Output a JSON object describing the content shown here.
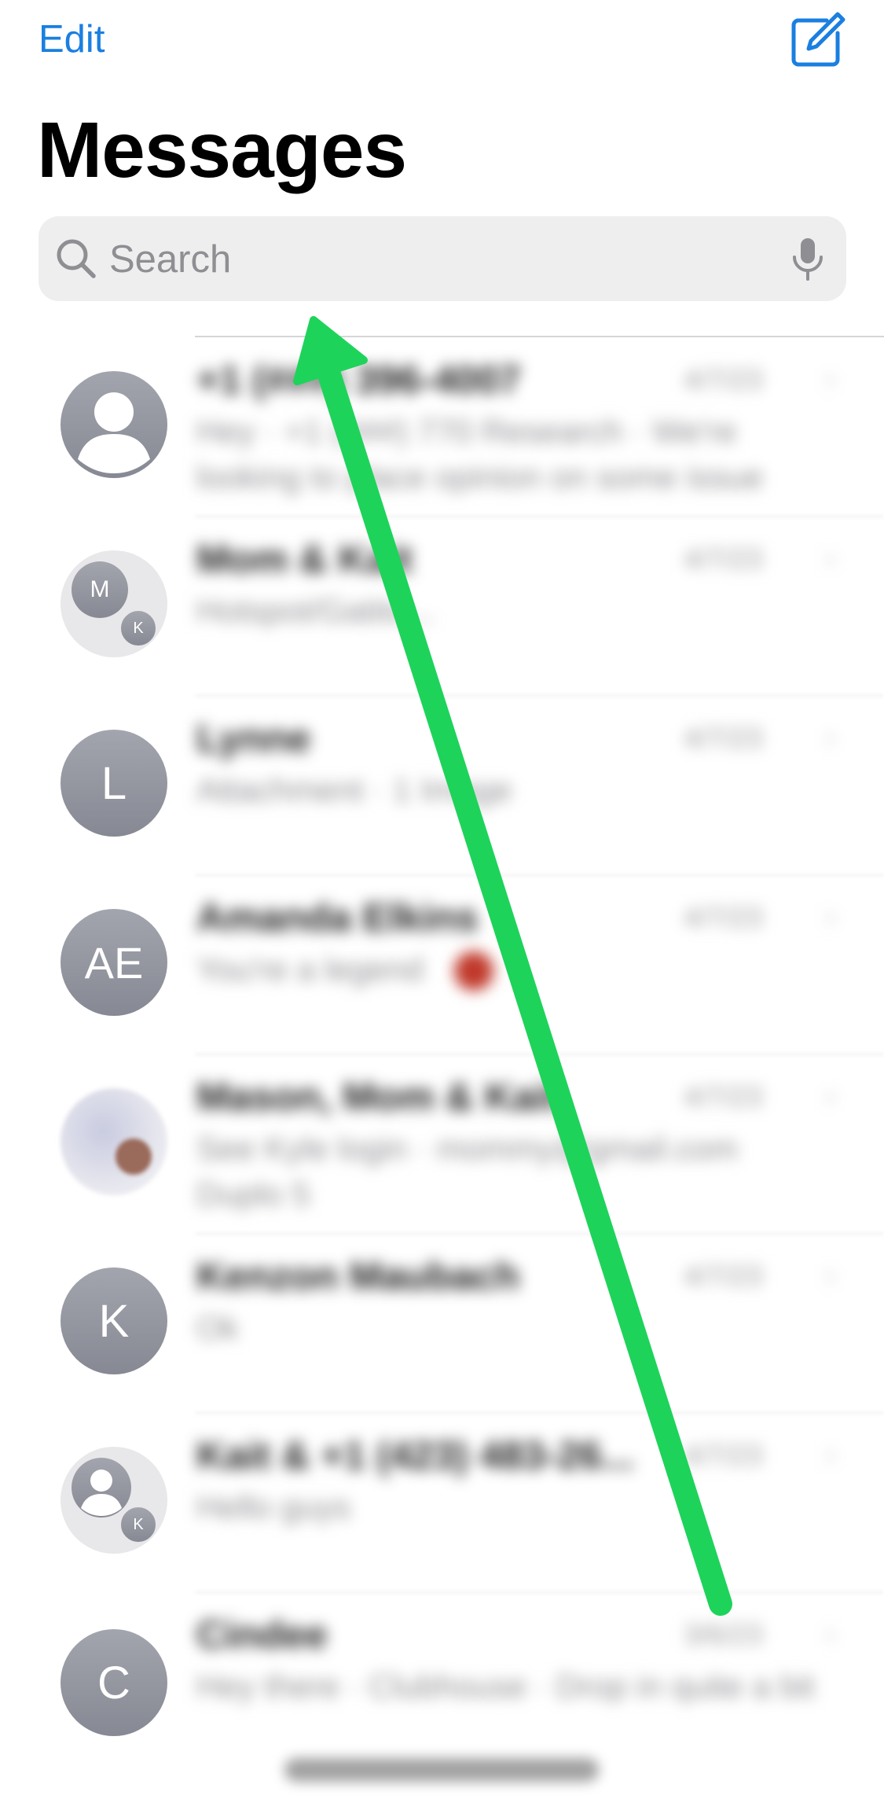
{
  "header": {
    "edit_label": "Edit",
    "title": "Messages",
    "compose_icon": "compose-icon"
  },
  "search": {
    "placeholder": "Search",
    "icon": "magnifier-icon",
    "mic_icon": "microphone-icon"
  },
  "conversations": [
    {
      "avatar": "person-silhouette",
      "initials": "",
      "name": "+1 (###) 396-4007",
      "timestamp": "4/7/23",
      "preview": "Hey · +1 (###) 770 Research · We're looking to place opinion on some issue"
    },
    {
      "avatar": "group",
      "initials": "M",
      "secondary_initials": "K",
      "name": "Mom & Kait",
      "timestamp": "4/7/23",
      "preview": "Hotspot/Gatito..."
    },
    {
      "avatar": "initials",
      "initials": "L",
      "name": "Lynne",
      "timestamp": "4/7/23",
      "preview": "Attachment · 1 Image"
    },
    {
      "avatar": "initials",
      "initials": "AE",
      "name": "Amanda Elkins",
      "timestamp": "4/7/23",
      "preview": "You're a legend"
    },
    {
      "avatar": "photo-group",
      "initials": "",
      "name": "Mason, Mom & Kait",
      "timestamp": "4/7/23",
      "preview": "See Kyle login · mommy@gmail.com Duplo 5"
    },
    {
      "avatar": "initials",
      "initials": "K",
      "name": "Kenzon Maubach",
      "timestamp": "4/7/23",
      "preview": "Ok"
    },
    {
      "avatar": "group-silhouette",
      "initials": "",
      "secondary_initials": "K",
      "name": "Kait & +1 (423) 483-26...",
      "timestamp": "4/7/23",
      "preview": "Hello guys"
    },
    {
      "avatar": "initials",
      "initials": "C",
      "name": "Cindee",
      "timestamp": "3/6/23",
      "preview": "Hey there · Clubhouse · Drop in quite a bit"
    }
  ],
  "overlay": {
    "arrow_color": "#1ed35a",
    "arrow_description_icon": "up-arrow-annotation"
  },
  "colors": {
    "accent": "#1a7fe0",
    "avatar_gray": "#8e9099"
  }
}
